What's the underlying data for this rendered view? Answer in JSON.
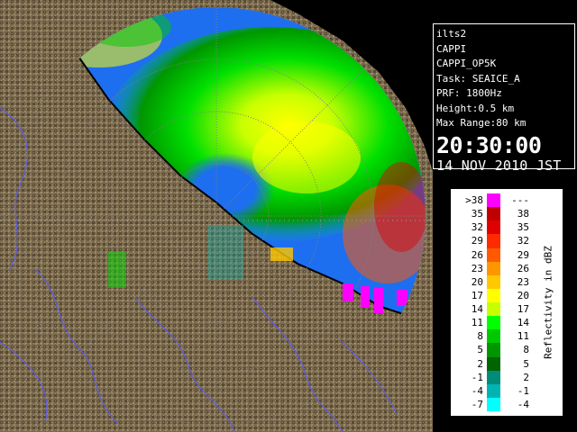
{
  "info": {
    "site": "ilts2",
    "product": "CAPPI",
    "product_code": "CAPPI_OP5K",
    "task": "Task: SEAICE_A",
    "prf": "PRF: 1800Hz",
    "height": "Height:0.5 km",
    "max_range": "Max Range:80 km",
    "time": "20:30:00",
    "date": "14 NOV 2010 JST"
  },
  "legend": {
    "label": "Reflectivity in dBZ",
    "rows": [
      {
        "lo": ">38",
        "hi": "---",
        "color": "#ff00ff"
      },
      {
        "lo": "35",
        "hi": "38",
        "color": "#c00000"
      },
      {
        "lo": "32",
        "hi": "35",
        "color": "#e00000"
      },
      {
        "lo": "29",
        "hi": "32",
        "color": "#ff2a00"
      },
      {
        "lo": "26",
        "hi": "29",
        "color": "#ff5a00"
      },
      {
        "lo": "23",
        "hi": "26",
        "color": "#ff9600"
      },
      {
        "lo": "20",
        "hi": "23",
        "color": "#ffc800"
      },
      {
        "lo": "17",
        "hi": "20",
        "color": "#ffff00"
      },
      {
        "lo": "14",
        "hi": "17",
        "color": "#c8ff00"
      },
      {
        "lo": "11",
        "hi": "14",
        "color": "#00ff00"
      },
      {
        "lo": "8",
        "hi": "11",
        "color": "#00c800"
      },
      {
        "lo": "5",
        "hi": "8",
        "color": "#009600"
      },
      {
        "lo": "2",
        "hi": "5",
        "color": "#006400"
      },
      {
        "lo": "-1",
        "hi": "2",
        "color": "#008c78"
      },
      {
        "lo": "-4",
        "hi": "-1",
        "color": "#00b4b4"
      },
      {
        "lo": "-7",
        "hi": "-4",
        "color": "#00ffff"
      }
    ]
  },
  "colors": {
    "background": "#000000",
    "sea_range": "#1e6ef0",
    "terrain": "#7a6a4e",
    "rivers": "#5a5aff",
    "range_rings": "#808080",
    "panel_text": "#ffffff"
  }
}
